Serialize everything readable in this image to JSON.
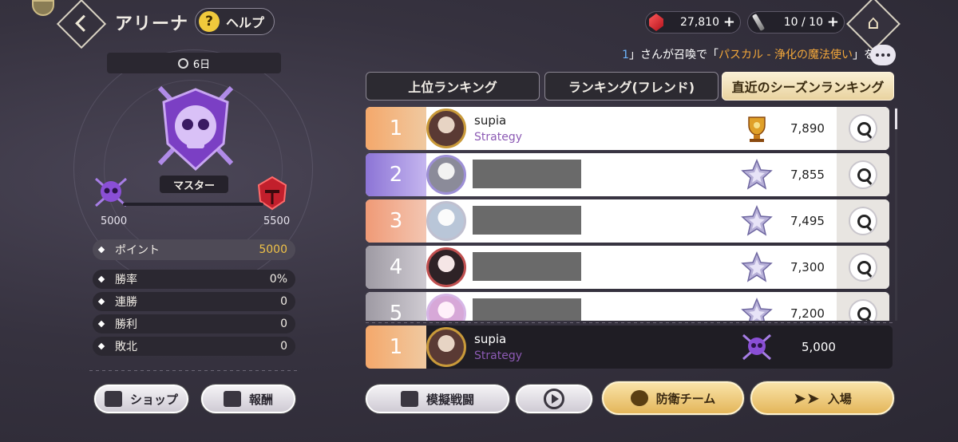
{
  "header": {
    "title": "アリーナ",
    "help_label": "ヘルプ",
    "help_icon": "?",
    "gems": "27,810",
    "tickets": "10 / 10",
    "plus": "+"
  },
  "ticker": {
    "prefix_num": "1",
    "text_a": "」さんが召喚で「",
    "highlight": "パスカル - 浄化の魔法使い",
    "text_b": "」を"
  },
  "season": {
    "days_left": "6日",
    "rank_name": "マスター",
    "current_min": "5000",
    "next_threshold": "5500",
    "progress": 0.0
  },
  "stats": [
    {
      "label": "ポイント",
      "value": "5000"
    },
    {
      "label": "勝率",
      "value": "0%"
    },
    {
      "label": "連勝",
      "value": "0"
    },
    {
      "label": "勝利",
      "value": "0"
    },
    {
      "label": "敗北",
      "value": "0"
    }
  ],
  "tabs": [
    {
      "label": "上位ランキング"
    },
    {
      "label": "ランキング(フレンド)"
    },
    {
      "label": "直近のシーズンランキング"
    }
  ],
  "ranking": [
    {
      "rank": "1",
      "name": "supia",
      "guild": "Strategy",
      "score": "7,890",
      "tier": "gold-trophy"
    },
    {
      "rank": "2",
      "name": "",
      "guild": "",
      "score": "7,855",
      "tier": "silver-star"
    },
    {
      "rank": "3",
      "name": "",
      "guild": "",
      "score": "7,495",
      "tier": "silver-star"
    },
    {
      "rank": "4",
      "name": "",
      "guild": "",
      "score": "7,300",
      "tier": "silver-star"
    },
    {
      "rank": "5",
      "name": "",
      "guild": "",
      "score": "7,200",
      "tier": "silver-star"
    }
  ],
  "my_rank": {
    "rank": "1",
    "name": "supia",
    "guild": "Strategy",
    "score": "5,000"
  },
  "buttons": {
    "shop": "ショップ",
    "reward": "報酬",
    "mock_battle": "模擬戦闘",
    "defense_team": "防衛チーム",
    "enter": "入場"
  },
  "colors": {
    "accent_gold": "#f0c248",
    "guild_purple": "#8c5ab4",
    "ticker_highlight": "#f3a73a"
  }
}
